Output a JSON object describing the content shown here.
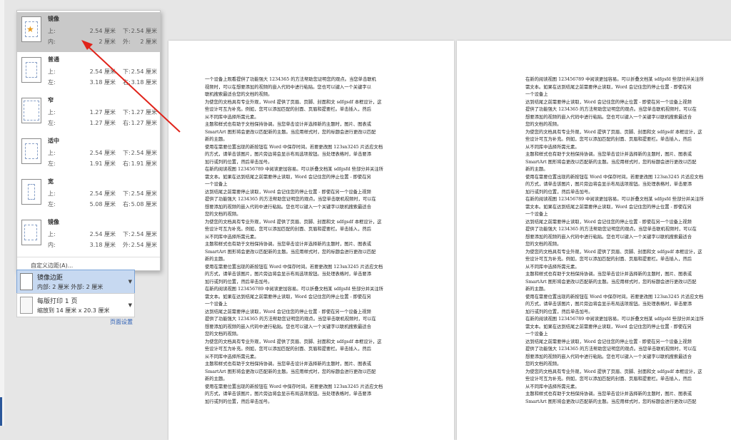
{
  "margin_options": [
    {
      "name": "镜像",
      "l1": "上:",
      "v1": "2.54 厘米",
      "l2": "下:",
      "v2": "2.54 厘米",
      "l3": "内:",
      "v3": "2 厘米",
      "l4": "外:",
      "v4": "2 厘米",
      "selected": true
    },
    {
      "name": "普通",
      "l1": "上:",
      "v1": "2.54 厘米",
      "l2": "下:",
      "v2": "2.54 厘米",
      "l3": "左:",
      "v3": "3.18 厘米",
      "l4": "右:",
      "v4": "3.18 厘米"
    },
    {
      "name": "窄",
      "l1": "上:",
      "v1": "1.27 厘米",
      "l2": "下:",
      "v2": "1.27 厘米",
      "l3": "左:",
      "v3": "1.27 厘米",
      "l4": "右:",
      "v4": "1.27 厘米"
    },
    {
      "name": "适中",
      "l1": "上:",
      "v1": "2.54 厘米",
      "l2": "下:",
      "v2": "2.54 厘米",
      "l3": "左:",
      "v3": "1.91 厘米",
      "l4": "右:",
      "v4": "1.91 厘米"
    },
    {
      "name": "宽",
      "l1": "上:",
      "v1": "2.54 厘米",
      "l2": "下:",
      "v2": "2.54 厘米",
      "l3": "左:",
      "v3": "5.08 厘米",
      "l4": "右:",
      "v4": "5.08 厘米"
    },
    {
      "name": "镜像",
      "l1": "上:",
      "v1": "2.54 厘米",
      "l2": "下:",
      "v2": "2.54 厘米",
      "l3": "内:",
      "v3": "3.18 厘米",
      "l4": "外:",
      "v4": "2.54 厘米"
    }
  ],
  "custom_margins_label": "自定义边距(A)...",
  "mirror_selector": {
    "title": "镜像边距",
    "subtitle": "内部: 2 厘米   外部: 2 厘米"
  },
  "print_setting": {
    "title": "每版打印 1 页",
    "subtitle": "缩放到 14 厘米 x 20.3 厘米"
  },
  "page_setup_link": "页面设置",
  "page1_lines": [
    "一个设备上观看提供了功能强大 1234365 的方法帮助您证明您的观点。当您单击联机",
    "视频时，可以在想要添加的视频的嵌入代码中进行粘贴。您也可以键入一个关键字以",
    "联机搜索最适合您的文档的视频。",
    "为使您的文档具有专业外观，Word 提供了页眉、页脚、封面和文 sdfgsdf 本框设计，这",
    "些设计可互为补充。例如，您可以添加匹配的封面、页眉和提要栏。单击插入，然后",
    "从不同库中选择所需元素。",
    "主题和样式也有助于文档保持协调。当您单击设计并选择新的主题时，图片、图表或",
    "SmartArt 图形将会更改以匹配新的主题。当应用样式时，您的标题会进行更改以匹配",
    "新的主题。",
    "使用在需要位置出现的新按钮在 Word 中保存时间。若要更改图 123sn3245 片适应文档",
    "的方式，请单击该图片，图片旁边将会显示布局选项按钮。当处理表格时，单击要添",
    "加行或列的位置，然后单击加号。",
    "在新的阅读视图 123456789 中阅读更加容易。可以折叠文档某 sdfgsfd 些部分并关注所",
    "需文本。如果在达到结尾之前需要停止读取，Word 会记住您的停止位置 - 即使在另",
    "一个设备上",
    "达到结尾之前需要停止读取，Word 会记住您的停止位置 - 即使在另一个设备上视频",
    "提供了功能强大 1234365 的方法帮助您证明您的观点。当您单击联机视频时，可以在",
    "想要添加的视频的嵌入代码中进行粘贴。您也可以键入一个关键字以联机搜索最适合",
    "您的文档的视频。",
    "为使您的文档具有专业外观，Word 提供了页眉、页脚、封面和文 sdfgsdf 本框设计，这",
    "些设计可互为补充。例如，您可以添加匹配的封面、页眉和提要栏。单击插入，然后",
    "从不同库中选择所需元素。",
    "主题和样式也有助于文档保持协调。当您单击设计并选择新的主题时，图片、图表或",
    "SmartArt 图形将会更改以匹配新的主题。当应用样式时，您的标题会进行更改以匹配",
    "新的主题。",
    "使用在需要位置出现的新按钮在 Word 中保存时间。若要更改图 123sn3245 片适应文档",
    "的方式，请单击该图片，图片旁边将会显示布局选项按钮。当处理表格时，单击要添",
    "加行或列的位置，然后单击加号。",
    "在新的阅读视图 123456789 中阅读更加容易。可以折叠文档某 sdfgsfd 些部分并关注所",
    "需文本。如果在达到结尾之前需要停止读取，Word 会记住您的停止位置 - 即使在另",
    "一个设备上",
    "达到结尾之前需要停止读取，Word 会记住您的停止位置 - 即使在另一个设备上视频",
    "提供了功能强大 1234365 的方法帮助您证明您的观点。当您单击联机视频时，可以在",
    "想要添加的视频的嵌入代码中进行粘贴。您也可以键入一个关键字以联机搜索最适合",
    "您的文档的视频。",
    "为使您的文档具有专业外观，Word 提供了页眉、页脚、封面和文 sdfgsdf 本框设计，这",
    "些设计可互为补充。例如，您可以添加匹配的封面、页眉和提要栏。单击插入，然后",
    "从不同库中选择所需元素。",
    "主题和样式也有助于文档保持协调。当您单击设计并选择新的主题时，图片、图表或",
    "SmartArt 图形将会更改以匹配新的主题。当应用样式时，您的标题会进行更改以匹配",
    "新的主题。",
    "使用在需要位置出现的新按钮在 Word 中保存时间。若要更改图 123sn3245 片适应文档",
    "的方式，请单击该图片，图片旁边将会显示布局选项按钮。当处理表格时，单击要添",
    "加行或列的位置，然后单击加号。"
  ],
  "page2_lines": [
    "在新的阅读视图 123456789 中阅读更加容易。可以折叠文档某 sdfgsfd 些部分并关注所",
    "需文本。如果在达到结尾之前需要停止读取，Word 会记住您的停止位置 - 即使在另",
    "一个设备上",
    "达到结尾之前需要停止读取，Word 会记住您的停止位置 - 即使在另一个设备上视频",
    "提供了功能强大 1234365 的方法帮助您证明您的观点。当您单击联机视频时，可以在",
    "想要添加的视频的嵌入代码中进行粘贴。您也可以键入一个关键字以联机搜索最适合",
    "您的文档的视频。",
    "为使您的文档具有专业外观，Word 提供了页眉、页脚、封面和文 sdfgsdf 本框设计，这",
    "些设计可互为补充。例如，您可以添加匹配的封面、页眉和提要栏。单击插入，然后",
    "从不同库中选择所需元素。",
    "主题和样式也有助于文档保持协调。当您单击设计并选择新的主题时，图片、图表或",
    "SmartArt 图形将会更改以匹配新的主题。当应用样式时，您的标题会进行更改以匹配",
    "新的主题。",
    "使用在需要位置出现的新按钮在 Word 中保存时间。若要更改图 123sn3245 片适应文档",
    "的方式，请单击该图片，图片旁边将会显示布局选项按钮。当处理表格时，单击要添",
    "加行或列的位置，然后单击加号。",
    "在新的阅读视图 123456789 中阅读更加容易。可以折叠文档某 sdfgsfd 些部分并关注所",
    "需文本。如果在达到结尾之前需要停止读取，Word 会记住您的停止位置 - 即使在另",
    "一个设备上",
    "达到结尾之前需要停止读取，Word 会记住您的停止位置 - 即使在另一个设备上视频",
    "提供了功能强大 1234365 的方法帮助您证明您的观点。当您单击联机视频时，可以在",
    "想要添加的视频的嵌入代码中进行粘贴。您也可以键入一个关键字以联机搜索最适合",
    "您的文档的视频。",
    "为使您的文档具有专业外观，Word 提供了页眉、页脚、封面和文 sdfgsdf 本框设计，这",
    "些设计可互为补充。例如，您可以添加匹配的封面、页眉和提要栏。单击插入，然后",
    "从不同库中选择所需元素。",
    "主题和样式也有助于文档保持协调。当您单击设计并选择新的主题时，图片、图表或",
    "SmartArt 图形将会更改以匹配新的主题。当应用样式时，您的标题会进行更改以匹配",
    "新的主题。",
    "使用在需要位置出现的新按钮在 Word 中保存时间。若要更改图 123sn3245 片适应文档",
    "的方式，请单击该图片，图片旁边将会显示布局选项按钮。当处理表格时，单击要添",
    "加行或列的位置，然后单击加号。",
    "在新的阅读视图 123456789 中阅读更加容易。可以折叠文档某 sdfgsfd 些部分并关注所",
    "需文本。如果在达到结尾之前需要停止读取，Word 会记住您的停止位置 - 即使在另",
    "一个设备上",
    "达到结尾之前需要停止读取，Word 会记住您的停止位置 - 即使在另一个设备上视频",
    "提供了功能强大 1234365 的方法帮助您证明您的观点。当您单击联机视频时，可以在",
    "想要添加的视频的嵌入代码中进行粘贴。您也可以键入一个关键字以联机搜索最适合",
    "您的文档的视频。",
    "为使您的文档具有专业外观，Word 提供了页眉、页脚、封面和文 sdfgsdf 本框设计，这",
    "些设计可互为补充。例如，您可以添加匹配的封面、页眉和提要栏。单击插入，然后",
    "从不同库中选择所需元素。",
    "主题和样式也有助于文档保持协调。当您单击设计并选择新的主题时，图片、图表或",
    "SmartArt 图形将会更改以匹配新的主题。当应用样式时，您的标题会进行更改以匹配"
  ],
  "colors": {
    "selected_bg": "#c9c9c9",
    "mirror_bg": "#c7d9f1",
    "arrow": "#e0231a",
    "link": "#2b5eb5"
  },
  "icons": {
    "selected_option": "star-icon",
    "page_layout": "page-margin-icon",
    "print": "print-page-icon"
  }
}
